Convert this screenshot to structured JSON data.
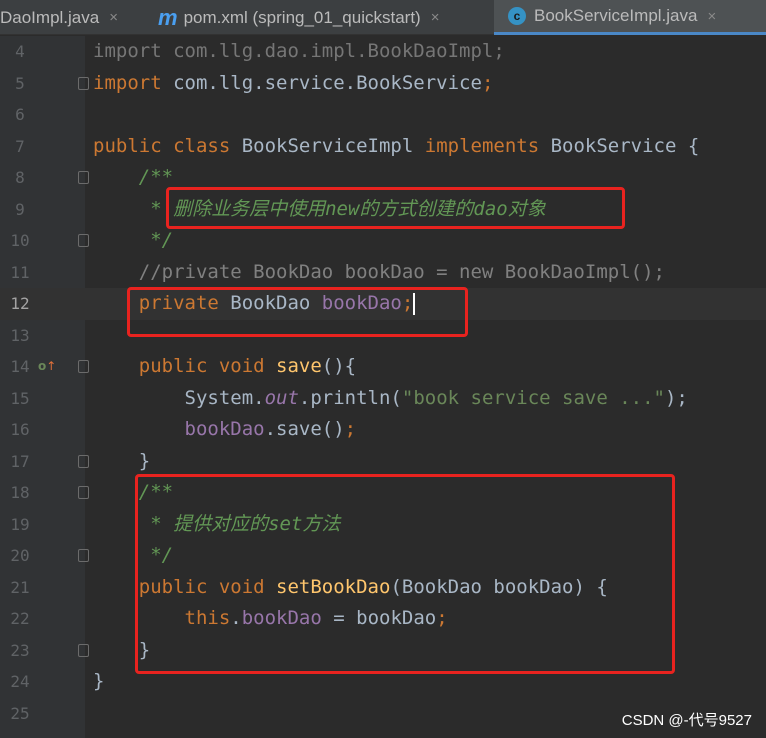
{
  "tabs": [
    {
      "label": "DaoImpl.java",
      "close": "×"
    },
    {
      "icon": "m",
      "label": "pom.xml (spring_01_quickstart)",
      "close": "×"
    },
    {
      "icon": "c",
      "label": "BookServiceImpl.java",
      "close": "×"
    }
  ],
  "lines": [
    {
      "n": "4"
    },
    {
      "n": "5"
    },
    {
      "n": "6"
    },
    {
      "n": "7"
    },
    {
      "n": "8"
    },
    {
      "n": "9"
    },
    {
      "n": "10"
    },
    {
      "n": "11"
    },
    {
      "n": "12"
    },
    {
      "n": "13"
    },
    {
      "n": "14"
    },
    {
      "n": "15"
    },
    {
      "n": "16"
    },
    {
      "n": "17"
    },
    {
      "n": "18"
    },
    {
      "n": "19"
    },
    {
      "n": "20"
    },
    {
      "n": "21"
    },
    {
      "n": "22"
    },
    {
      "n": "23"
    },
    {
      "n": "24"
    },
    {
      "n": "25"
    }
  ],
  "code": {
    "l4_a": "import com.llg.dao.impl.BookDaoImpl",
    "l4_b": ";",
    "l5_kw": "import",
    "l5_a": " com.llg.service.BookService",
    "l5_b": ";",
    "l7_kw1": "public class",
    "l7_a": " BookServiceImpl ",
    "l7_kw2": "implements",
    "l7_b": " BookService {",
    "l8": "    /**",
    "l9_star": "     * ",
    "l9_text": "删除业务层中使用new的方式创建的dao对象",
    "l10": "     */",
    "l11": "    //private BookDao bookDao = new BookDaoImpl();",
    "l12_kw": "    private",
    "l12_a": " BookDao ",
    "l12_f": "bookDao",
    "l12_b": ";",
    "l14_kw": "    public void",
    "l14_fn": " save",
    "l14_a": "(){",
    "l15_a": "        System.",
    "l15_f": "out",
    "l15_b": ".println(",
    "l15_s": "\"book service save ...\"",
    "l15_c": ");",
    "l16_f": "        bookDao",
    "l16_a": ".save()",
    "l16_b": ";",
    "l17": "    }",
    "l18": "    /**",
    "l19_star": "     * ",
    "l19_text": "提供对应的set方法",
    "l20": "     */",
    "l21_kw": "    public void",
    "l21_fn": " setBookDao",
    "l21_a": "(BookDao bookDao) {",
    "l22_kw": "        this",
    "l22_a": ".",
    "l22_f": "bookDao",
    "l22_b": " = bookDao",
    "l22_c": ";",
    "l23": "    }",
    "l24": "}"
  },
  "gutter_icon": {
    "o": "o",
    "arrow": "↑"
  },
  "highlight_color": "#e8231f",
  "watermark": "CSDN @-代号9527"
}
